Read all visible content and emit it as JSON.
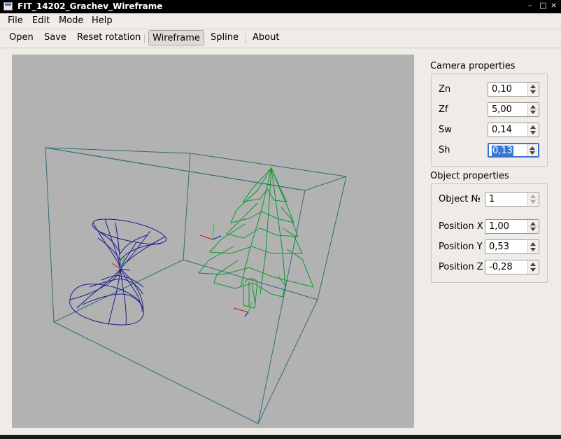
{
  "window": {
    "title": "FIT_14202_Grachev_Wireframe",
    "min_glyph": "–",
    "max_glyph": "□",
    "close_glyph": "×"
  },
  "menu": [
    "File",
    "Edit",
    "Mode",
    "Help"
  ],
  "toolbar": {
    "open": "Open",
    "save": "Save",
    "reset": "Reset rotation",
    "wireframe": "Wireframe",
    "spline": "Spline",
    "about": "About"
  },
  "camera": {
    "title": "Camera properties",
    "fields": [
      {
        "label": "Zn",
        "value": "0,10"
      },
      {
        "label": "Zf",
        "value": "5,00"
      },
      {
        "label": "Sw",
        "value": "0,14"
      },
      {
        "label": "Sh",
        "value": "0,13"
      }
    ]
  },
  "object": {
    "title": "Object properties",
    "number_label": "Object №",
    "number_value": "1",
    "fields": [
      {
        "label": "Position X",
        "value": "1,00"
      },
      {
        "label": "Position Y",
        "value": "0,53"
      },
      {
        "label": "Position Z",
        "value": "-0,28"
      }
    ]
  },
  "colors": {
    "box": "#2e6e73",
    "hourglass": "#1e1e8c",
    "tree": "#0a9a2a",
    "viewport_bg": "#b2b2b2"
  }
}
